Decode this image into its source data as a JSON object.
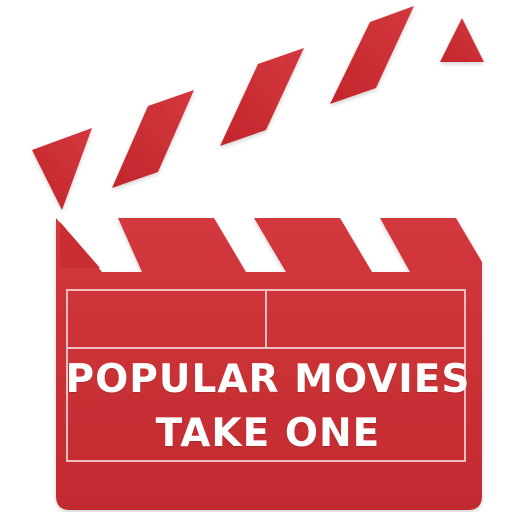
{
  "icon": {
    "name": "clapperboard-icon",
    "colors": {
      "primary_red": "#cc2b30",
      "dark_red": "#b31d23",
      "light_red": "#d94a4e",
      "stripe_white": "#ffffff",
      "line": "#f2c7c8"
    }
  },
  "slate": {
    "line1": "POPULAR MOVIES",
    "line2": "TAKE ONE"
  }
}
